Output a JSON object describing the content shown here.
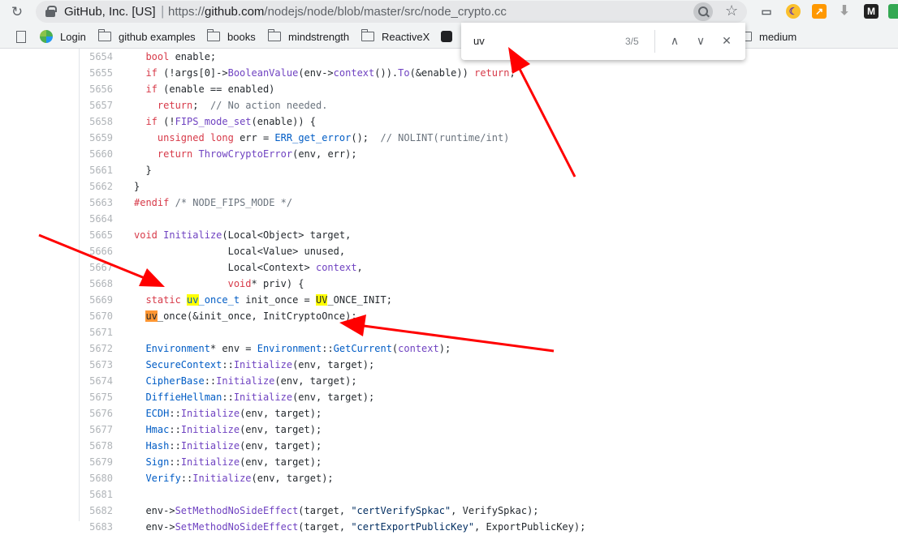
{
  "toolbar": {
    "reload_icon": "reload-icon",
    "site_identity": "GitHub, Inc. [US]",
    "separator": "|",
    "url_scheme": "https://",
    "url_host": "github.com",
    "url_path": "/nodejs/node/blob/master/src/node_crypto.cc"
  },
  "bookmarks": [
    {
      "label": "",
      "icon": "document-icon"
    },
    {
      "label": "Login",
      "icon": "login-site-icon"
    },
    {
      "label": "github examples",
      "icon": "folder-icon"
    },
    {
      "label": "books",
      "icon": "folder-icon"
    },
    {
      "label": "mindstrength",
      "icon": "folder-icon"
    },
    {
      "label": "ReactiveX",
      "icon": "folder-icon"
    },
    {
      "label": "medium",
      "icon": "folder-icon"
    }
  ],
  "find_bar": {
    "query": "uv",
    "count": "3/5",
    "prev_glyph": "∧",
    "next_glyph": "∨",
    "close_glyph": "✕"
  },
  "colors": {
    "match_highlight": "#ffff00",
    "current_match_highlight": "#ff9632",
    "annotation_arrow": "#ff0000"
  },
  "code": {
    "lines": [
      {
        "n": "5654",
        "t": "  bool enable;"
      },
      {
        "n": "5655",
        "t": "  if (!args[0]->BooleanValue(env->context()).To(&enable)) return;"
      },
      {
        "n": "5656",
        "t": "  if (enable == enabled)"
      },
      {
        "n": "5657",
        "t": "    return;  // No action needed."
      },
      {
        "n": "5658",
        "t": "  if (!FIPS_mode_set(enable)) {"
      },
      {
        "n": "5659",
        "t": "    unsigned long err = ERR_get_error();  // NOLINT(runtime/int)"
      },
      {
        "n": "5660",
        "t": "    return ThrowCryptoError(env, err);"
      },
      {
        "n": "5661",
        "t": "  }"
      },
      {
        "n": "5662",
        "t": "}"
      },
      {
        "n": "5663",
        "t": "#endif /* NODE_FIPS_MODE */"
      },
      {
        "n": "5664",
        "t": ""
      },
      {
        "n": "5665",
        "t": "void Initialize(Local<Object> target,"
      },
      {
        "n": "5666",
        "t": "                Local<Value> unused,"
      },
      {
        "n": "5667",
        "t": "                Local<Context> context,"
      },
      {
        "n": "5668",
        "t": "                void* priv) {"
      },
      {
        "n": "5669",
        "t": "  static uv_once_t init_once = UV_ONCE_INIT;"
      },
      {
        "n": "5670",
        "t": "  uv_once(&init_once, InitCryptoOnce);"
      },
      {
        "n": "5671",
        "t": ""
      },
      {
        "n": "5672",
        "t": "  Environment* env = Environment::GetCurrent(context);"
      },
      {
        "n": "5673",
        "t": "  SecureContext::Initialize(env, target);"
      },
      {
        "n": "5674",
        "t": "  CipherBase::Initialize(env, target);"
      },
      {
        "n": "5675",
        "t": "  DiffieHellman::Initialize(env, target);"
      },
      {
        "n": "5676",
        "t": "  ECDH::Initialize(env, target);"
      },
      {
        "n": "5677",
        "t": "  Hmac::Initialize(env, target);"
      },
      {
        "n": "5678",
        "t": "  Hash::Initialize(env, target);"
      },
      {
        "n": "5679",
        "t": "  Sign::Initialize(env, target);"
      },
      {
        "n": "5680",
        "t": "  Verify::Initialize(env, target);"
      },
      {
        "n": "5681",
        "t": ""
      },
      {
        "n": "5682",
        "t": "  env->SetMethodNoSideEffect(target, \"certVerifySpkac\", VerifySpkac);"
      },
      {
        "n": "5683",
        "t": "  env->SetMethodNoSideEffect(target, \"certExportPublicKey\", ExportPublicKey);"
      }
    ]
  }
}
